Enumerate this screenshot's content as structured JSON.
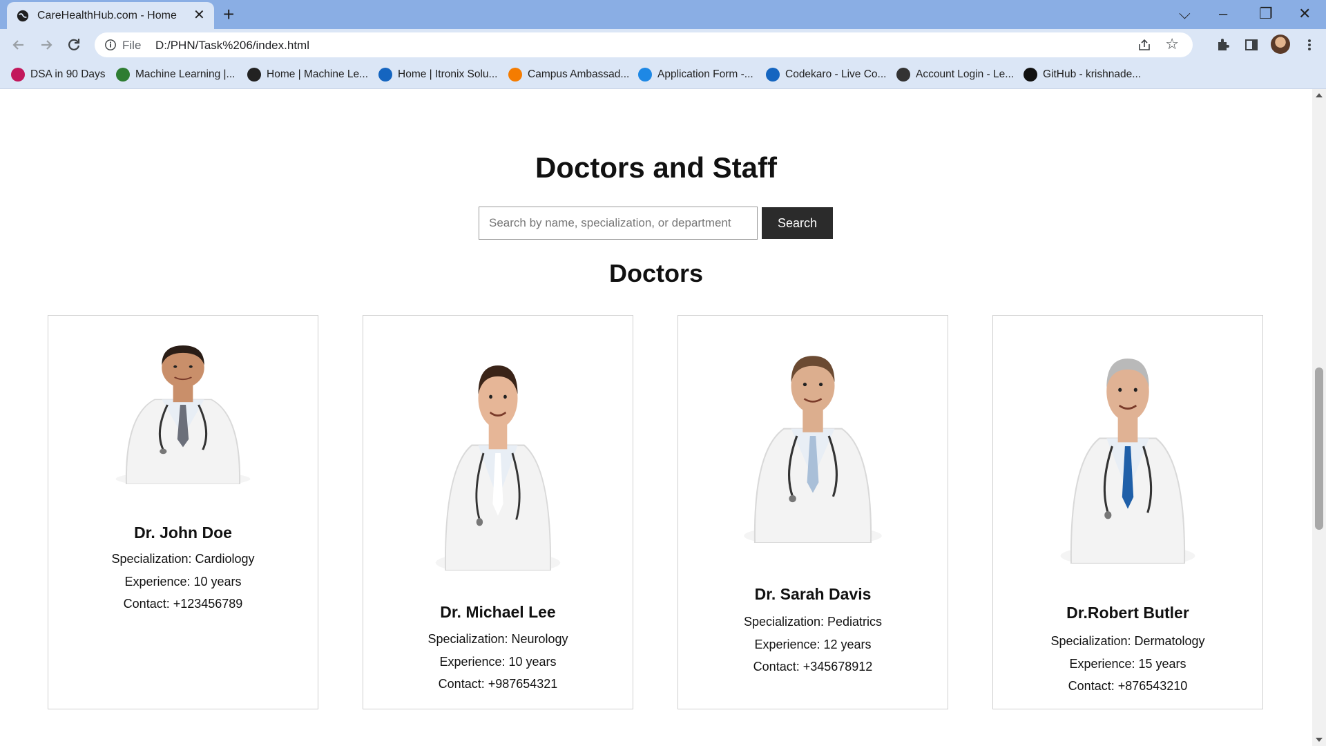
{
  "browser": {
    "tab_title": "CareHealthHub.com - Home",
    "address_scheme": "File",
    "address_url": "D:/PHN/Task%206/index.html",
    "bookmarks": [
      {
        "label": "DSA in 90 Days",
        "icon": "dsa-icon",
        "color": "#c2185b"
      },
      {
        "label": "Machine Learning |...",
        "icon": "code-brackets-icon",
        "color": "#2e7d32"
      },
      {
        "label": "Home | Machine Le...",
        "icon": "ml-logo-icon",
        "color": "#222222"
      },
      {
        "label": "Home | Itronix Solu...",
        "icon": "itronix-icon",
        "color": "#1565c0"
      },
      {
        "label": "Campus Ambassad...",
        "icon": "campus-icon",
        "color": "#f57c00"
      },
      {
        "label": "Application Form -...",
        "icon": "skype-icon",
        "color": "#1e88e5"
      },
      {
        "label": "Codekaro - Live Co...",
        "icon": "codekaro-icon",
        "color": "#1565c0"
      },
      {
        "label": "Account Login - Le...",
        "icon": "leetcode-icon",
        "color": "#333333"
      },
      {
        "label": "GitHub - krishnade...",
        "icon": "github-icon",
        "color": "#111111"
      }
    ]
  },
  "page": {
    "title": "Doctors and Staff",
    "search_placeholder": "Search by name, specialization, or department",
    "search_button": "Search",
    "section_title": "Doctors"
  },
  "doctors": [
    {
      "name": "Dr. John Doe",
      "specialization": "Specialization: Cardiology",
      "experience": "Experience: 10 years",
      "contact": "Contact: +123456789",
      "tie_color": "#6b6f7a",
      "skin": "#c98f6a",
      "hair": "#2a1d16"
    },
    {
      "name": "Dr. Michael Lee",
      "specialization": "Specialization: Neurology",
      "experience": "Experience: 10 years",
      "contact": "Contact: +987654321",
      "tie_color": "#ffffff",
      "skin": "#e6b697",
      "hair": "#3a2418"
    },
    {
      "name": "Dr. Sarah Davis",
      "specialization": "Specialization: Pediatrics",
      "experience": "Experience: 12 years",
      "contact": "Contact: +345678912",
      "tie_color": "#a9bfd8",
      "skin": "#dcae8e",
      "hair": "#6b4a32"
    },
    {
      "name": "Dr.Robert Butler",
      "specialization": "Specialization: Dermatology",
      "experience": "Experience: 15 years",
      "contact": "Contact: +876543210",
      "tie_color": "#1f5fa8",
      "skin": "#e0b294",
      "hair": "#b9b9b9"
    }
  ]
}
